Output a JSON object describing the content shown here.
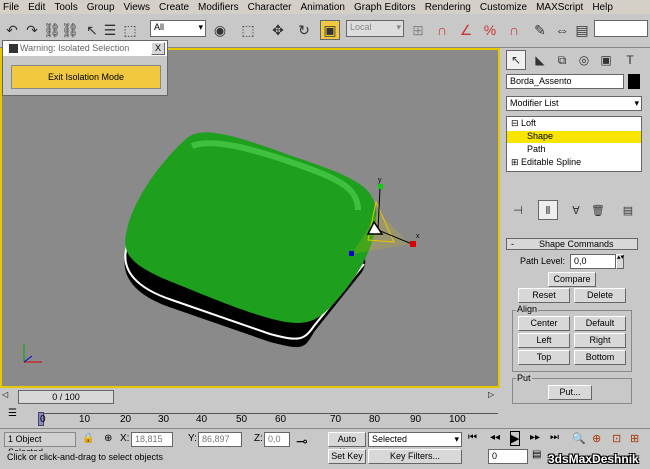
{
  "menu": [
    "File",
    "Edit",
    "Tools",
    "Group",
    "Views",
    "Create",
    "Modifiers",
    "Character",
    "Animation",
    "Graph Editors",
    "Rendering",
    "Customize",
    "MAXScript",
    "Help"
  ],
  "toolbar": {
    "selection_filter": "All",
    "coord_system": "Local"
  },
  "warning": {
    "title": "Warning: Isolated Selection",
    "close": "X",
    "exit_label": "Exit Isolation Mode"
  },
  "command_panel": {
    "object_name": "Borda_Assento",
    "modifier_list": "Modifier List",
    "stack": {
      "loft": "Loft",
      "shape": "Shape",
      "path": "Path",
      "editable_spline": "Editable Spline"
    },
    "rollout_title": "Shape Commands",
    "path_level_label": "Path Level:",
    "path_level_value": "0,0",
    "compare": "Compare",
    "reset": "Reset",
    "delete": "Delete",
    "align_group": "Align",
    "center": "Center",
    "default": "Default",
    "left": "Left",
    "right": "Right",
    "top": "Top",
    "bottom": "Bottom",
    "put_group": "Put",
    "put_button": "Put..."
  },
  "timeline": {
    "frame_display": "0 / 100",
    "ticks": [
      "0",
      "10",
      "20",
      "30",
      "40",
      "50",
      "60",
      "70",
      "80",
      "90",
      "100"
    ]
  },
  "status": {
    "selection_count": "1 Object Selected",
    "prompt": "Click or click-and-drag to select objects",
    "x_label": "X:",
    "x_value": "18,815",
    "y_label": "Y:",
    "y_value": "86,897",
    "z_label": "Z:",
    "z_value": "0,0",
    "auto_key": "Auto Key",
    "set_key": "Set Key",
    "key_mode": "Selected",
    "key_filters": "Key Filters...",
    "current_frame": "0",
    "watermark": "3dsMaxDeshnik"
  }
}
